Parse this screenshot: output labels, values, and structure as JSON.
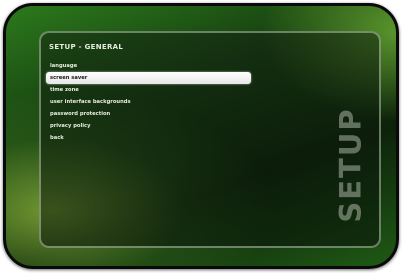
{
  "screen": {
    "title": "SETUP - GENERAL",
    "side_label": "SETUP"
  },
  "menu": {
    "selected_index": 1,
    "items": [
      {
        "label": "language"
      },
      {
        "label": "screen saver"
      },
      {
        "label": "time zone"
      },
      {
        "label": "user interface backgrounds"
      },
      {
        "label": "password protection"
      },
      {
        "label": "privacy policy"
      },
      {
        "label": "back"
      }
    ]
  },
  "colors": {
    "accent_green": "#2c7a1c",
    "highlight": "#ffffff",
    "text": "#e8eede"
  }
}
